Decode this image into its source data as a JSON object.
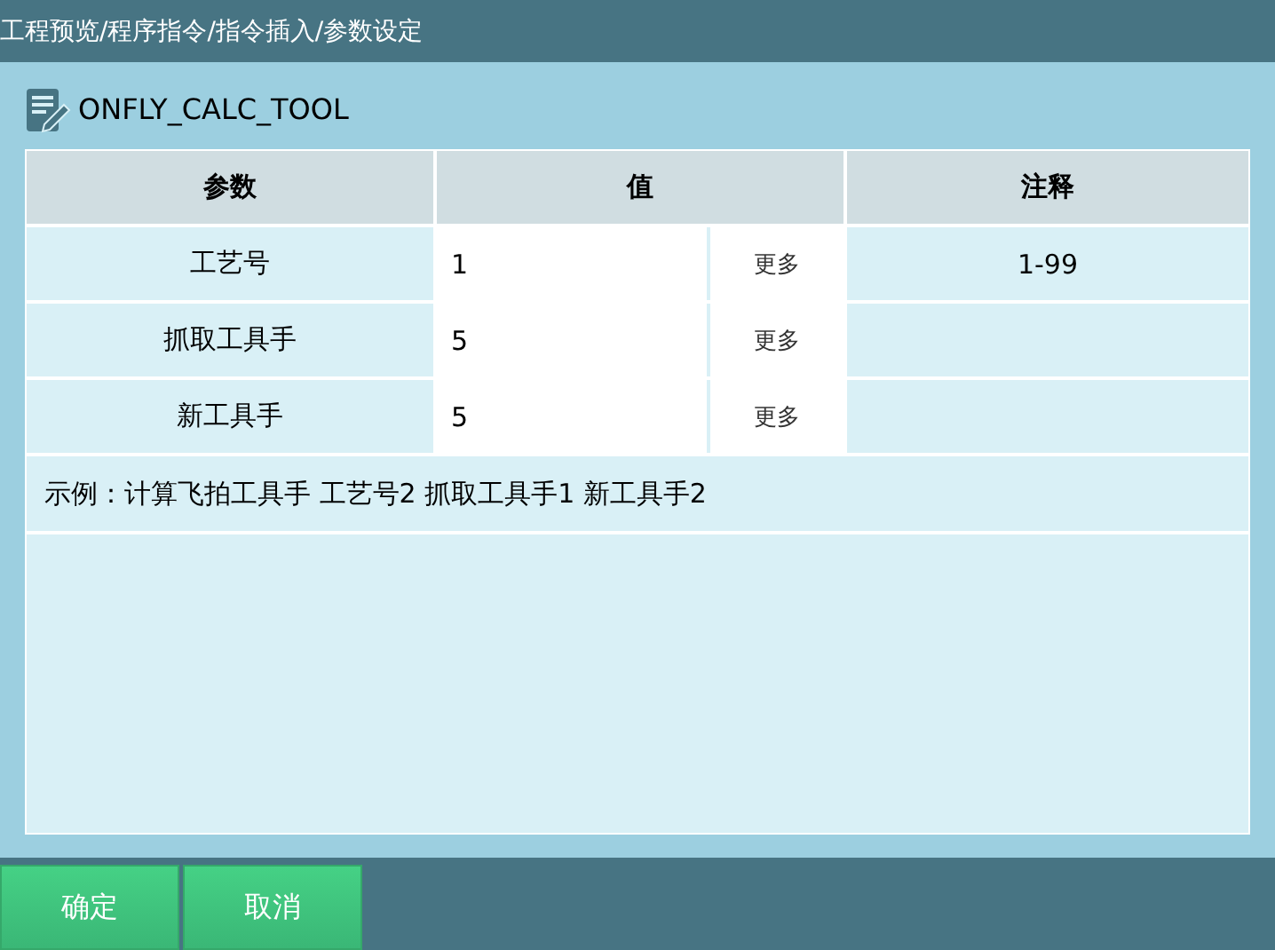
{
  "breadcrumb": "工程预览/程序指令/指令插入/参数设定",
  "instruction": "ONFLY_CALC_TOOL",
  "columns": [
    "参数",
    "值",
    "注释"
  ],
  "rows": [
    {
      "param": "工艺号",
      "value": "1",
      "more": "更多",
      "note": "1-99"
    },
    {
      "param": "抓取工具手",
      "value": "5",
      "more": "更多"
    },
    {
      "param": "新工具手",
      "value": "5",
      "more": "更多"
    }
  ],
  "example": "示例：计算飞拍工具手 工艺号2 抓取工具手1 新工具手2",
  "buttons": [
    "确定",
    "取消"
  ]
}
